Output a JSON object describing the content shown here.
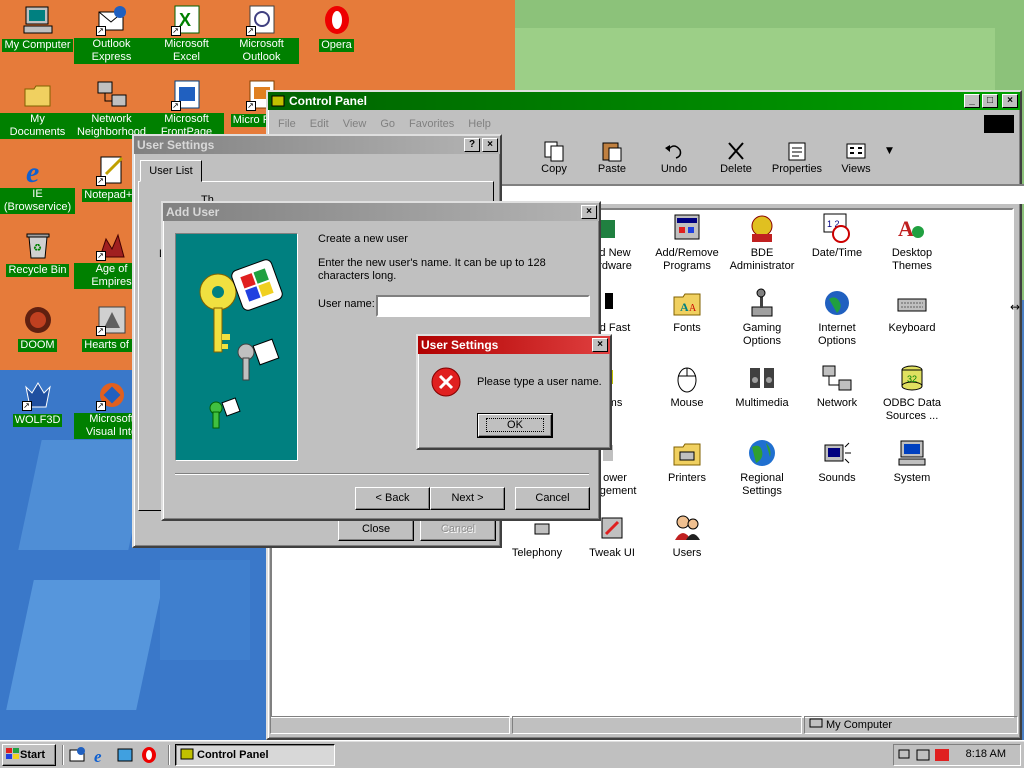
{
  "desktop": {
    "icons": [
      {
        "label": "My Computer"
      },
      {
        "label": "Outlook Express"
      },
      {
        "label": "Microsoft Excel"
      },
      {
        "label": "Microsoft Outlook"
      },
      {
        "label": "Opera"
      },
      {
        "label": "My Documents"
      },
      {
        "label": "Network Neighborhood"
      },
      {
        "label": "Microsoft FrontPage"
      },
      {
        "label": "Micro Powe"
      },
      {
        "label": "IE (Browservice)"
      },
      {
        "label": "Notepad++"
      },
      {
        "label": "Recycle Bin"
      },
      {
        "label": "Age of Empires"
      },
      {
        "label": "DOOM"
      },
      {
        "label": "Hearts of Ir"
      },
      {
        "label": "WOLF3D"
      },
      {
        "label": "Microsoft Visual Inte"
      }
    ]
  },
  "control_panel": {
    "title": "Control Panel",
    "menu": [
      "File",
      "Edit",
      "View",
      "Go",
      "Favorites",
      "Help"
    ],
    "toolbar": [
      "Copy",
      "Paste",
      "Undo",
      "Delete",
      "Properties",
      "Views"
    ],
    "toolbar_partial": "t",
    "items": [
      {
        "label": "d New\nrdware"
      },
      {
        "label": "Add/Remove\nPrograms"
      },
      {
        "label": "BDE\nAdministrator"
      },
      {
        "label": "Date/Time"
      },
      {
        "label": "Desktop\nThemes"
      },
      {
        "label": "d Fast"
      },
      {
        "label": "Fonts"
      },
      {
        "label": "Gaming\nOptions"
      },
      {
        "label": "Internet\nOptions"
      },
      {
        "label": "Keyboard"
      },
      {
        "label": "ms"
      },
      {
        "label": "Mouse"
      },
      {
        "label": "Multimedia"
      },
      {
        "label": "Network"
      },
      {
        "label": "ODBC Data\nSources ..."
      },
      {
        "label": "ower\nagement"
      },
      {
        "label": "Printers"
      },
      {
        "label": "Regional\nSettings"
      },
      {
        "label": "Sounds"
      },
      {
        "label": "System"
      },
      {
        "label": "Telephony"
      },
      {
        "label": "Tweak UI"
      },
      {
        "label": "Users"
      }
    ],
    "status_location": "My Computer"
  },
  "user_settings": {
    "title": "User Settings",
    "tab": "User List",
    "partial_text": "Th",
    "partial_row": "L",
    "close_btn": "Close",
    "cancel_btn": "Cancel"
  },
  "add_user": {
    "title": "Add User",
    "heading": "Create a new user",
    "description": "Enter the new user's name. It can be up to 128 characters long.",
    "field_label": "User name:",
    "field_value": "",
    "back_btn": "< Back",
    "next_btn": "Next >",
    "cancel_btn": "Cancel"
  },
  "error_dialog": {
    "title": "User Settings",
    "message": "Please type a user name.",
    "ok_btn": "OK"
  },
  "taskbar": {
    "start": "Start",
    "task": "Control Panel",
    "clock": "8:18 AM"
  }
}
